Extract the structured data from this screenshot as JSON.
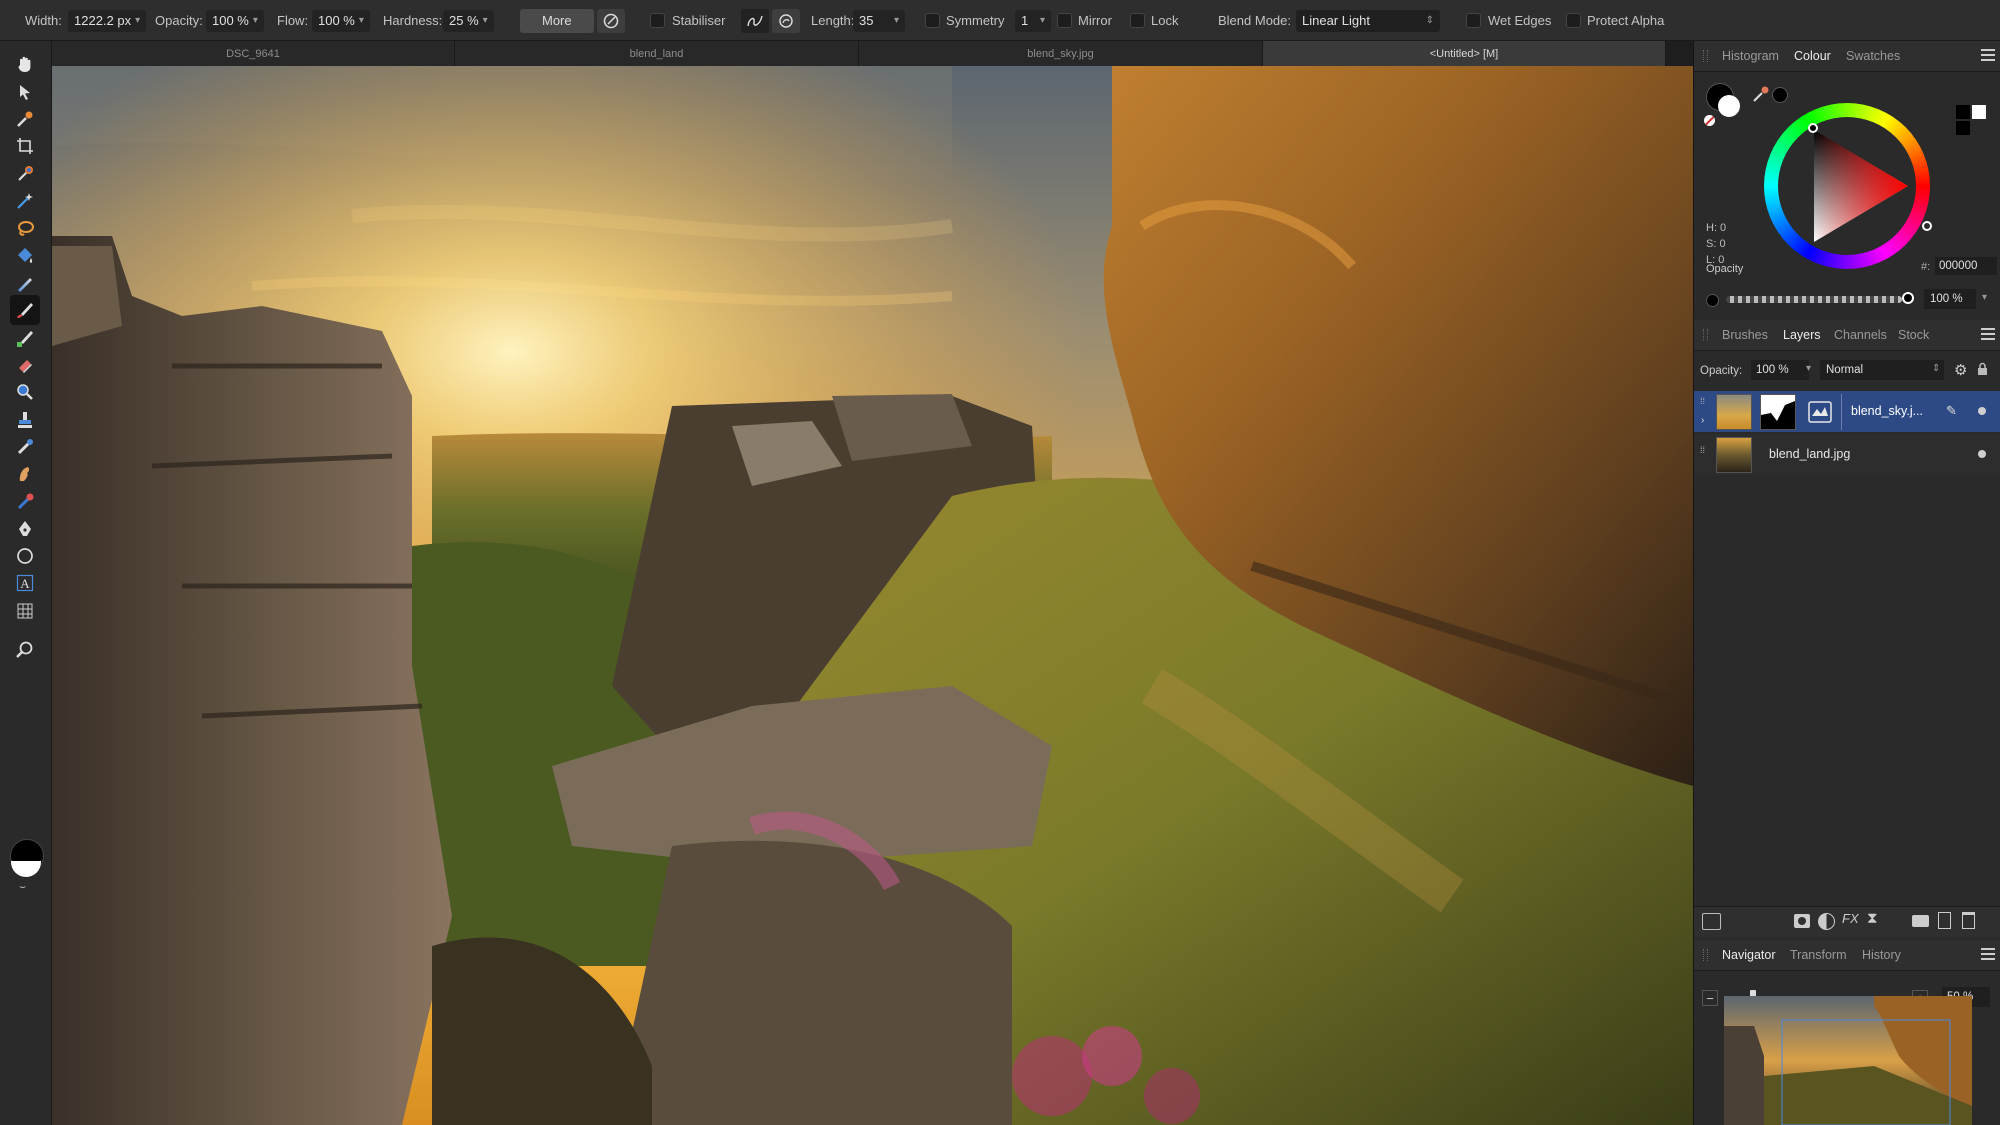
{
  "toolbar": {
    "width_label": "Width:",
    "width_value": "1222.2 px",
    "opacity_label": "Opacity:",
    "opacity_value": "100 %",
    "flow_label": "Flow:",
    "flow_value": "100 %",
    "hardness_label": "Hardness:",
    "hardness_value": "25 %",
    "more_label": "More",
    "stabiliser_label": "Stabiliser",
    "length_label": "Length:",
    "length_value": "35",
    "symmetry_label": "Symmetry",
    "symmetry_value": "1",
    "mirror_label": "Mirror",
    "lock_label": "Lock",
    "blend_mode_label": "Blend Mode:",
    "blend_mode_value": "Linear Light",
    "wet_edges_label": "Wet Edges",
    "protect_alpha_label": "Protect Alpha"
  },
  "documents": {
    "tabs": [
      {
        "label": "DSC_9641",
        "active": false
      },
      {
        "label": "blend_land",
        "active": false
      },
      {
        "label": "blend_sky.jpg",
        "active": false
      },
      {
        "label": "<Untitled> [M]",
        "active": true
      }
    ]
  },
  "tools": [
    "hand-icon",
    "move-icon",
    "color-picker-icon",
    "crop-icon",
    "flood-select-icon",
    "selection-brush-icon",
    "freehand-selection-icon",
    "flood-fill-icon",
    "gradient-icon",
    "paint-brush-icon",
    "pixel-icon",
    "eraser-icon",
    "zoom-icon",
    "clone-icon",
    "healing-icon",
    "smudge-icon",
    "dodge-icon",
    "pen-icon",
    "ellipse-icon",
    "text-icon",
    "mesh-warp-icon",
    "view-zoom-icon"
  ],
  "colour_panel": {
    "tabs": [
      "Histogram",
      "Colour",
      "Swatches"
    ],
    "active_tab": "Colour",
    "h": "H: 0",
    "s": "S: 0",
    "l": "L: 0",
    "hex_label": "#:",
    "hex_value": "000000",
    "opacity_label": "Opacity",
    "opacity_value": "100 %",
    "opacity_fraction": 1.0,
    "primary_color": "#000000",
    "secondary_color": "#ffffff"
  },
  "layers_panel": {
    "tabs": [
      "Brushes",
      "Layers",
      "Channels",
      "Stock"
    ],
    "active_tab": "Layers",
    "opacity_label": "Opacity:",
    "opacity_value": "100 %",
    "blend_value": "Normal",
    "layers": [
      {
        "name": "blend_sky.j...",
        "selected": true
      },
      {
        "name": "blend_land.jpg",
        "selected": false
      }
    ]
  },
  "navigator_panel": {
    "tabs": [
      "Navigator",
      "Transform",
      "History"
    ],
    "active_tab": "Navigator",
    "zoom_value": "50 %",
    "zoom_fraction": 0.15
  },
  "colors": {
    "accent": "#2d4a86",
    "layer_selected": "#2d4a86",
    "panel_bg": "#2a2a2a"
  }
}
